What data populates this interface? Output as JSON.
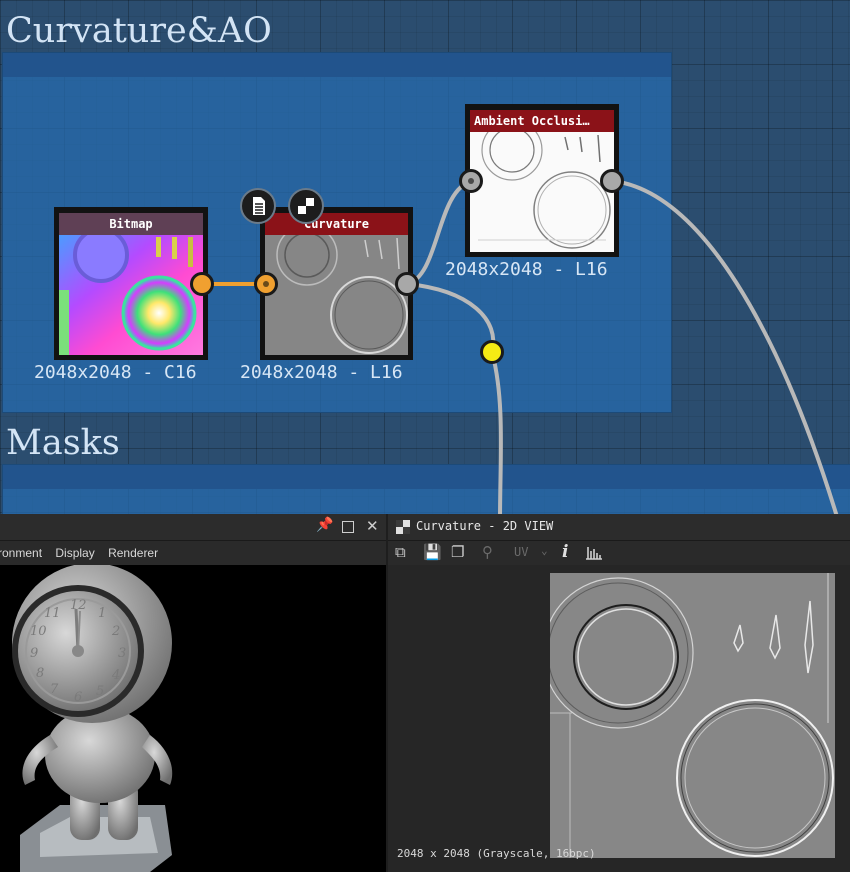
{
  "graph": {
    "frames": [
      {
        "title": "Curvature&AO"
      },
      {
        "title": "Masks"
      }
    ],
    "nodes": {
      "bitmap": {
        "title": "Bitmap",
        "label": "2048x2048 - C16",
        "color": "#5f4055"
      },
      "curvature": {
        "title": "Curvature",
        "label": "2048x2048 - L16",
        "color": "#8b1218"
      },
      "ao": {
        "title": "Ambient Occlusi…",
        "label": "2048x2048 - L16",
        "color": "#8b1218"
      }
    },
    "badges": [
      {
        "icon": "document-icon"
      },
      {
        "icon": "checker-icon"
      }
    ],
    "colors": {
      "port_orange": "#f0a030",
      "port_gray": "#a8a8a8",
      "port_yellow": "#f5ea14",
      "wire_gray": "#b9b9b9"
    }
  },
  "view3d": {
    "menu": [
      "ronment",
      "Display",
      "Renderer"
    ],
    "title_icons": [
      "pin-icon",
      "maximize-icon",
      "close-icon"
    ]
  },
  "view2d": {
    "title": "Curvature - 2D VIEW",
    "toolbar": [
      "view-layout-icon",
      "save-icon",
      "copy-icon",
      "share-icon",
      "UV",
      "chevron-down-icon",
      "i",
      "histogram-icon"
    ],
    "uv_label": "UV",
    "info_label": "i",
    "status": "2048 x 2048 (Grayscale, 16bpc)"
  }
}
